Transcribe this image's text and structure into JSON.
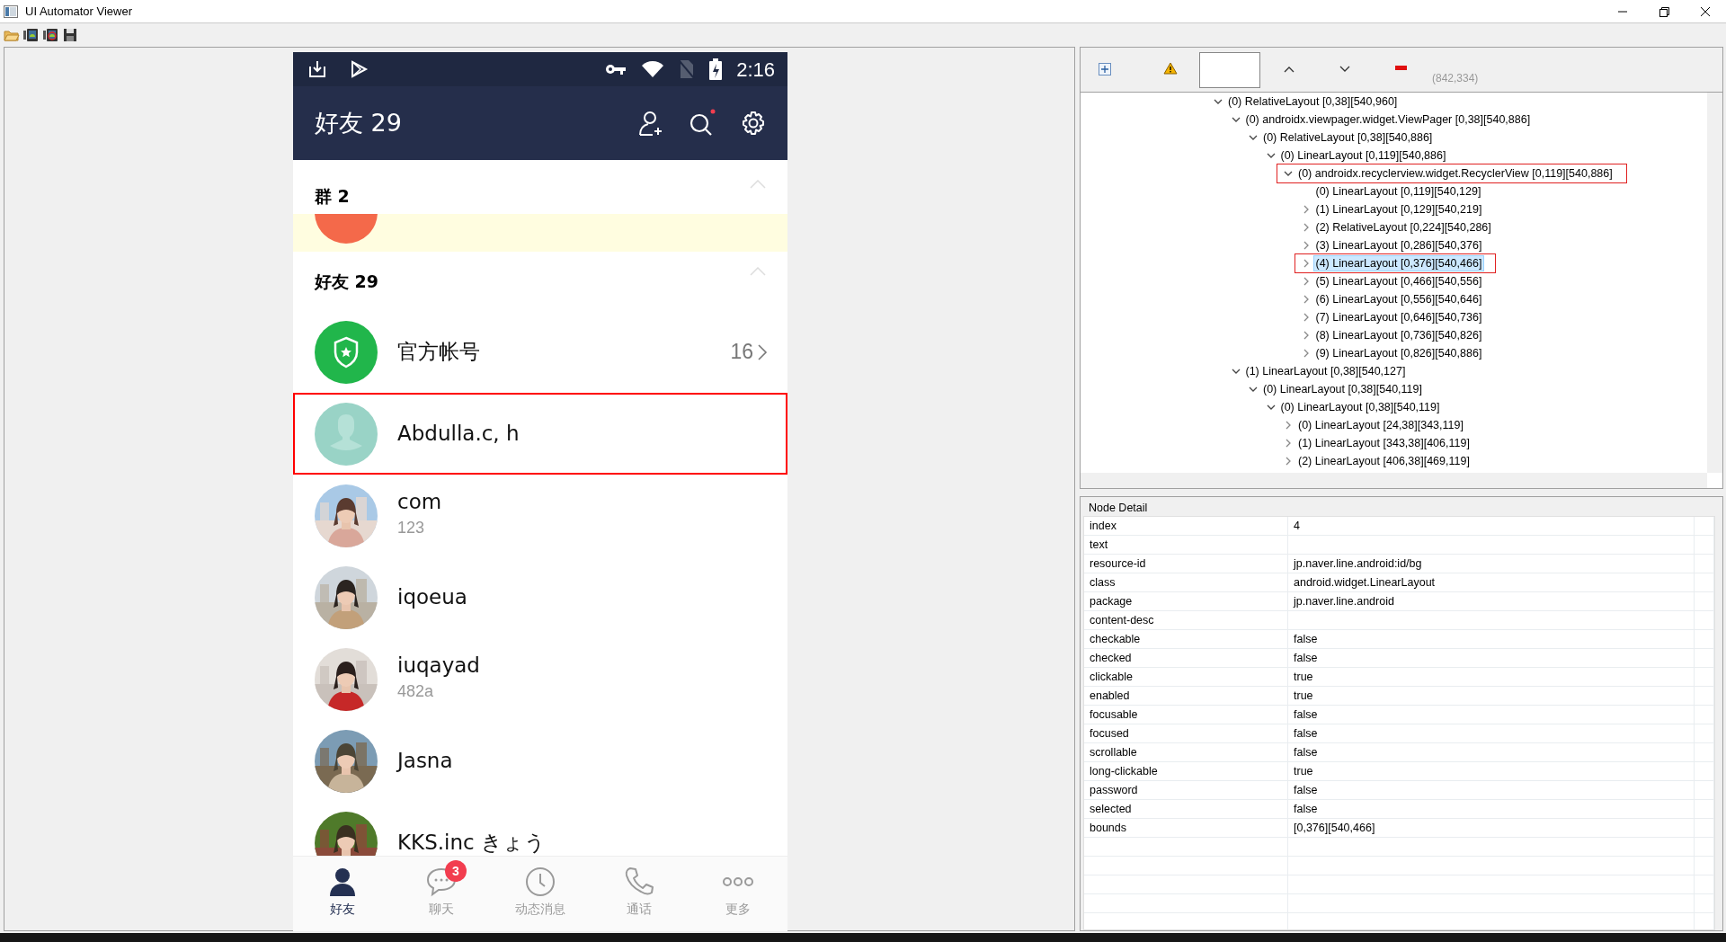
{
  "window": {
    "title": "UI Automator Viewer"
  },
  "phone": {
    "status_bar": {
      "time": "2:16"
    },
    "header": {
      "title": "好友 29"
    },
    "sections": [
      {
        "title": "群 2",
        "collapsed": false,
        "kind": "group",
        "rows": [
          {
            "avatar": {
              "kind": "cut",
              "color": "#f4694a"
            }
          }
        ]
      },
      {
        "title": "好友 29",
        "collapsed": false,
        "kind": "friends",
        "rows": [
          {
            "name": "官方帐号",
            "count": "16",
            "avatar": {
              "kind": "official"
            },
            "selected": false
          },
          {
            "name": "Abdulla.c, h",
            "avatar": {
              "kind": "default"
            },
            "selected": true
          },
          {
            "name": "com",
            "status": "123",
            "selected": false
          },
          {
            "name": "iqoeua",
            "selected": false
          },
          {
            "name": "iuqayad",
            "status": "482a",
            "selected": false
          },
          {
            "name": "Jasna",
            "selected": false
          },
          {
            "name": "KKS.inc きょう",
            "selected": false
          }
        ]
      }
    ],
    "nav": [
      {
        "label": "好友",
        "selected": true
      },
      {
        "label": "聊天",
        "badge": "3",
        "selected": false
      },
      {
        "label": "动态消息",
        "selected": false
      },
      {
        "label": "通话",
        "selected": false
      },
      {
        "label": "更多",
        "selected": false
      }
    ]
  },
  "coordinates": "(842,334)",
  "tree": [
    {
      "label": "(0) RelativeLayout [0,38][540,960]",
      "expanded": true,
      "selected": false,
      "children": [
        {
          "label": "(0) androidx.viewpager.widget.ViewPager [0,38][540,886]",
          "expanded": true,
          "selected": false,
          "children": [
            {
              "label": "(0) RelativeLayout [0,38][540,886]",
              "expanded": true,
              "selected": false,
              "children": [
                {
                  "label": "(0) LinearLayout [0,119][540,886]",
                  "expanded": true,
                  "selected": false,
                  "children": [
                    {
                      "label": "(0) androidx.recyclerview.widget.RecyclerView [0,119][540,886]",
                      "expanded": true,
                      "selected": false,
                      "annotated": true,
                      "children": [
                        {
                          "label": "(0) LinearLayout [0,119][540,129]",
                          "selected": false
                        },
                        {
                          "label": "(1) LinearLayout [0,129][540,219]",
                          "expanded": false,
                          "selected": false
                        },
                        {
                          "label": "(2) RelativeLayout [0,224][540,286]",
                          "expanded": false,
                          "selected": false
                        },
                        {
                          "label": "(3) LinearLayout [0,286][540,376]",
                          "expanded": false,
                          "selected": false
                        },
                        {
                          "label": "(4) LinearLayout [0,376][540,466]",
                          "expanded": false,
                          "selected": true,
                          "annotated": true
                        },
                        {
                          "label": "(5) LinearLayout [0,466][540,556]",
                          "expanded": false,
                          "selected": false
                        },
                        {
                          "label": "(6) LinearLayout [0,556][540,646]",
                          "expanded": false,
                          "selected": false
                        },
                        {
                          "label": "(7) LinearLayout [0,646][540,736]",
                          "expanded": false,
                          "selected": false
                        },
                        {
                          "label": "(8) LinearLayout [0,736][540,826]",
                          "expanded": false,
                          "selected": false
                        },
                        {
                          "label": "(9) LinearLayout [0,826][540,886]",
                          "expanded": false,
                          "selected": false
                        }
                      ]
                    }
                  ]
                }
              ]
            }
          ]
        },
        {
          "label": "(1) LinearLayout [0,38][540,127]",
          "expanded": true,
          "selected": false,
          "children": [
            {
              "label": "(0) LinearLayout [0,38][540,119]",
              "expanded": true,
              "selected": false,
              "children": [
                {
                  "label": "(0) LinearLayout [0,38][540,119]",
                  "expanded": true,
                  "selected": false,
                  "children": [
                    {
                      "label": "(0) LinearLayout [24,38][343,119]",
                      "expanded": false,
                      "selected": false
                    },
                    {
                      "label": "(1) LinearLayout [343,38][406,119]",
                      "expanded": false,
                      "selected": false
                    },
                    {
                      "label": "(2) LinearLayout [406,38][469,119]",
                      "expanded": false,
                      "selected": false
                    }
                  ]
                }
              ]
            }
          ]
        }
      ]
    }
  ],
  "node_detail": {
    "title": "Node Detail",
    "rows": [
      {
        "key": "index",
        "value": "4"
      },
      {
        "key": "text"
      },
      {
        "key": "resource-id",
        "value": "jp.naver.line.android:id/bg"
      },
      {
        "key": "class",
        "value": "android.widget.LinearLayout"
      },
      {
        "key": "package",
        "value": "jp.naver.line.android"
      },
      {
        "key": "content-desc"
      },
      {
        "key": "checkable",
        "value": "false"
      },
      {
        "key": "checked",
        "value": "false"
      },
      {
        "key": "clickable",
        "value": "true"
      },
      {
        "key": "enabled",
        "value": "true"
      },
      {
        "key": "focusable",
        "value": "false"
      },
      {
        "key": "focused",
        "value": "false"
      },
      {
        "key": "scrollable",
        "value": "false"
      },
      {
        "key": "long-clickable",
        "value": "true"
      },
      {
        "key": "password",
        "value": "false"
      },
      {
        "key": "selected",
        "value": "false"
      },
      {
        "key": "bounds",
        "value": "[0,376][540,466]"
      }
    ]
  }
}
